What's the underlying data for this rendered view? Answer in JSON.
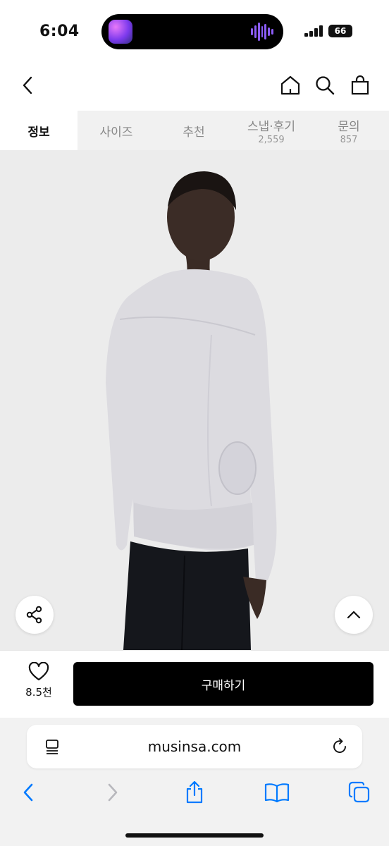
{
  "status_bar": {
    "time": "6:04",
    "battery": "66"
  },
  "tabs": [
    {
      "label": "정보",
      "count": ""
    },
    {
      "label": "사이즈",
      "count": ""
    },
    {
      "label": "추천",
      "count": ""
    },
    {
      "label": "스냅·후기",
      "count": "2,559"
    },
    {
      "label": "문의",
      "count": "857"
    }
  ],
  "purchase": {
    "like_count": "8.5천",
    "buy_label": "구매하기"
  },
  "browser": {
    "url": "musinsa.com"
  },
  "colors": {
    "accent": "#007aff",
    "buy_button": "#000000",
    "tab_bg": "#f1f1f1"
  }
}
